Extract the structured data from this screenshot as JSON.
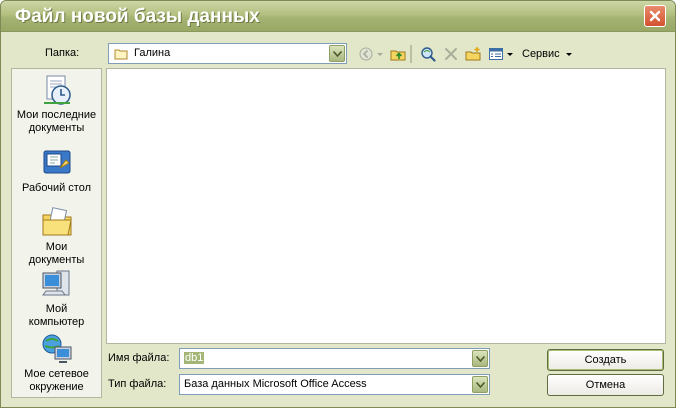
{
  "window": {
    "title": "Файл новой базы данных"
  },
  "toolbar": {
    "folder_label": "Папка:",
    "folder_value": "Галина",
    "tools_label": "Сервис"
  },
  "places": [
    {
      "label_1": "Мои последние",
      "label_2": "документы"
    },
    {
      "label_1": "Рабочий стол",
      "label_2": ""
    },
    {
      "label_1": "Мои",
      "label_2": "документы"
    },
    {
      "label_1": "Мой",
      "label_2": "компьютер"
    },
    {
      "label_1": "Мое сетевое",
      "label_2": "окружение"
    }
  ],
  "form": {
    "filename_label": "Имя файла:",
    "filename_value": "db1",
    "filetype_label": "Тип файла:",
    "filetype_value": "База данных Microsoft Office Access"
  },
  "buttons": {
    "create": "Создать",
    "cancel": "Отмена"
  }
}
